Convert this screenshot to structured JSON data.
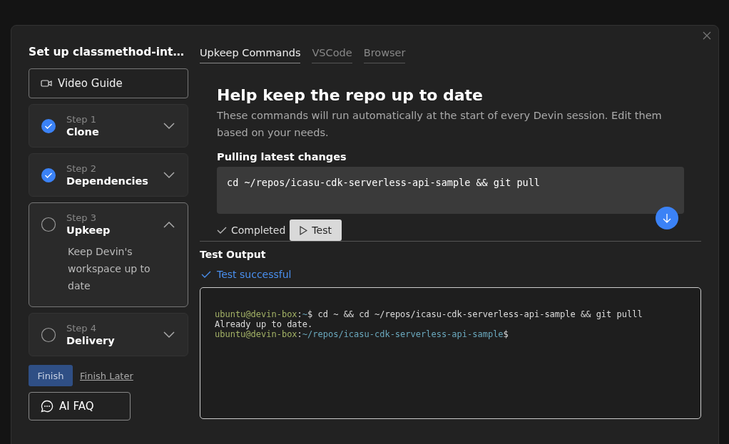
{
  "sidebar": {
    "title": "Set up classmethod-int…",
    "video_button": "Video Guide",
    "steps": [
      {
        "step": "Step 1",
        "name": "Clone",
        "done": true,
        "expanded": false
      },
      {
        "step": "Step 2",
        "name": "Dependencies",
        "done": true,
        "expanded": false
      },
      {
        "step": "Step 3",
        "name": "Upkeep",
        "done": false,
        "expanded": true,
        "description": "Keep Devin's workspace up to date"
      },
      {
        "step": "Step 4",
        "name": "Delivery",
        "done": false,
        "expanded": false
      }
    ],
    "finish_button": "Finish",
    "finish_later": "Finish Later",
    "faq_button": "AI FAQ"
  },
  "tabs": [
    {
      "label": "Upkeep Commands",
      "selected": true
    },
    {
      "label": "VSCode",
      "selected": false
    },
    {
      "label": "Browser",
      "selected": false
    }
  ],
  "heading": "Help keep the repo up to date",
  "description": "These commands will run automatically at the start of every Devin session. Edit them based on your needs.",
  "command": {
    "label": "Pulling latest changes",
    "value": "cd ~/repos/icasu-cdk-serverless-api-sample && git pull",
    "status": "Completed",
    "test_button": "Test"
  },
  "output": {
    "label": "Test Output",
    "status": "Test successful",
    "lines": [
      [
        {
          "kind": "user",
          "text": "ubuntu@devin-box"
        },
        {
          "kind": "plain",
          "text": ":"
        },
        {
          "kind": "path",
          "text": "~"
        },
        {
          "kind": "plain",
          "text": "$ cd ~ && cd ~/repos/icasu-cdk-serverless-api-sample && git pulll"
        }
      ],
      [
        {
          "kind": "plain",
          "text": "Already up to date."
        }
      ],
      [
        {
          "kind": "user",
          "text": "ubuntu@devin-box"
        },
        {
          "kind": "plain",
          "text": ":"
        },
        {
          "kind": "path",
          "text": "~/repos/icasu-cdk-serverless-api-sample"
        },
        {
          "kind": "plain",
          "text": "$"
        }
      ]
    ]
  }
}
